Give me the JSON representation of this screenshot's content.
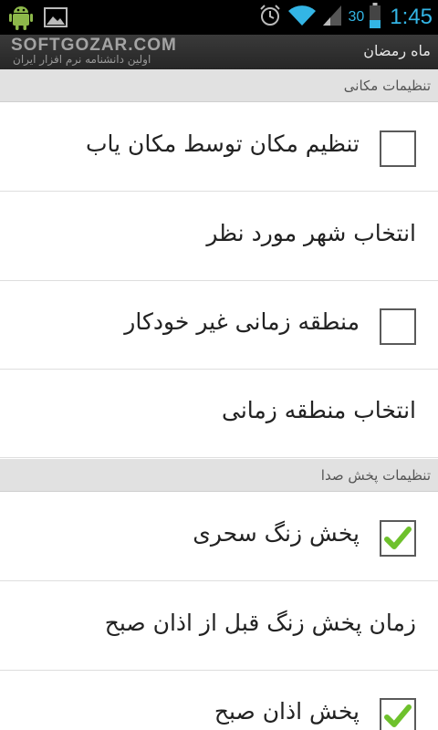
{
  "status_bar": {
    "battery_level": "30",
    "time": "1:45",
    "icons": [
      "android-icon",
      "image-icon",
      "alarm-icon",
      "wifi-icon",
      "signal-icon",
      "battery-icon"
    ]
  },
  "action_bar": {
    "title": "ماه رمضان",
    "watermark_title": "SOFTGOZAR.COM",
    "watermark_subtitle": "اولین دانشنامه نرم افزار ایران"
  },
  "sections": [
    {
      "title": "تنظیمات مکانی",
      "items": [
        {
          "label": "تنظیم مکان توسط مکان یاب",
          "type": "checkbox",
          "checked": false
        },
        {
          "label": "انتخاب شهر مورد نظر",
          "type": "link"
        },
        {
          "label": "منطقه زمانی غیر خودکار",
          "type": "checkbox",
          "checked": false
        },
        {
          "label": "انتخاب منطقه زمانی",
          "type": "link"
        }
      ]
    },
    {
      "title": "تنظیمات پخش صدا",
      "items": [
        {
          "label": "پخش زنگ سحری",
          "type": "checkbox",
          "checked": true
        },
        {
          "label": "زمان پخش زنگ قبل از اذان صبح",
          "type": "link"
        },
        {
          "label": "پخش اذان صبح",
          "type": "checkbox",
          "checked": true
        }
      ]
    }
  ],
  "colors": {
    "accent": "#33b5e5",
    "check": "#6ec12c"
  }
}
